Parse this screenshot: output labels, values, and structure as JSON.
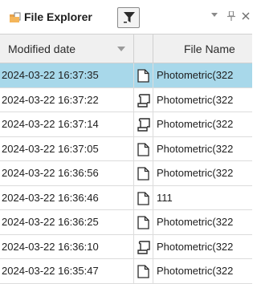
{
  "panel": {
    "title": "File Explorer",
    "title_icon": "folder-icon",
    "filter_icon": "filter-icon",
    "menu_icon": "dropdown-arrow-icon",
    "pin_icon": "pin-icon",
    "close_icon": "close-icon",
    "selection_color": "#a8d8ea"
  },
  "table": {
    "columns": [
      {
        "label": "Modified date",
        "sort": "descending"
      },
      {
        "label": ""
      },
      {
        "label": "File Name"
      }
    ],
    "rows": [
      {
        "date": "2024-03-22 16:37:35",
        "type": "document",
        "name": "Photometric(322",
        "selected": true
      },
      {
        "date": "2024-03-22 16:37:22",
        "type": "scroll",
        "name": "Photometric(322",
        "selected": false
      },
      {
        "date": "2024-03-22 16:37:14",
        "type": "scroll",
        "name": "Photometric(322",
        "selected": false
      },
      {
        "date": "2024-03-22 16:37:05",
        "type": "document",
        "name": "Photometric(322",
        "selected": false
      },
      {
        "date": "2024-03-22 16:36:56",
        "type": "document",
        "name": "Photometric(322",
        "selected": false
      },
      {
        "date": "2024-03-22 16:36:46",
        "type": "document",
        "name": "111",
        "selected": false
      },
      {
        "date": "2024-03-22 16:36:25",
        "type": "document",
        "name": "Photometric(322",
        "selected": false
      },
      {
        "date": "2024-03-22 16:36:10",
        "type": "scroll",
        "name": "Photometric(322",
        "selected": false
      },
      {
        "date": "2024-03-22 16:35:47",
        "type": "document",
        "name": "Photometric(322",
        "selected": false
      }
    ]
  }
}
